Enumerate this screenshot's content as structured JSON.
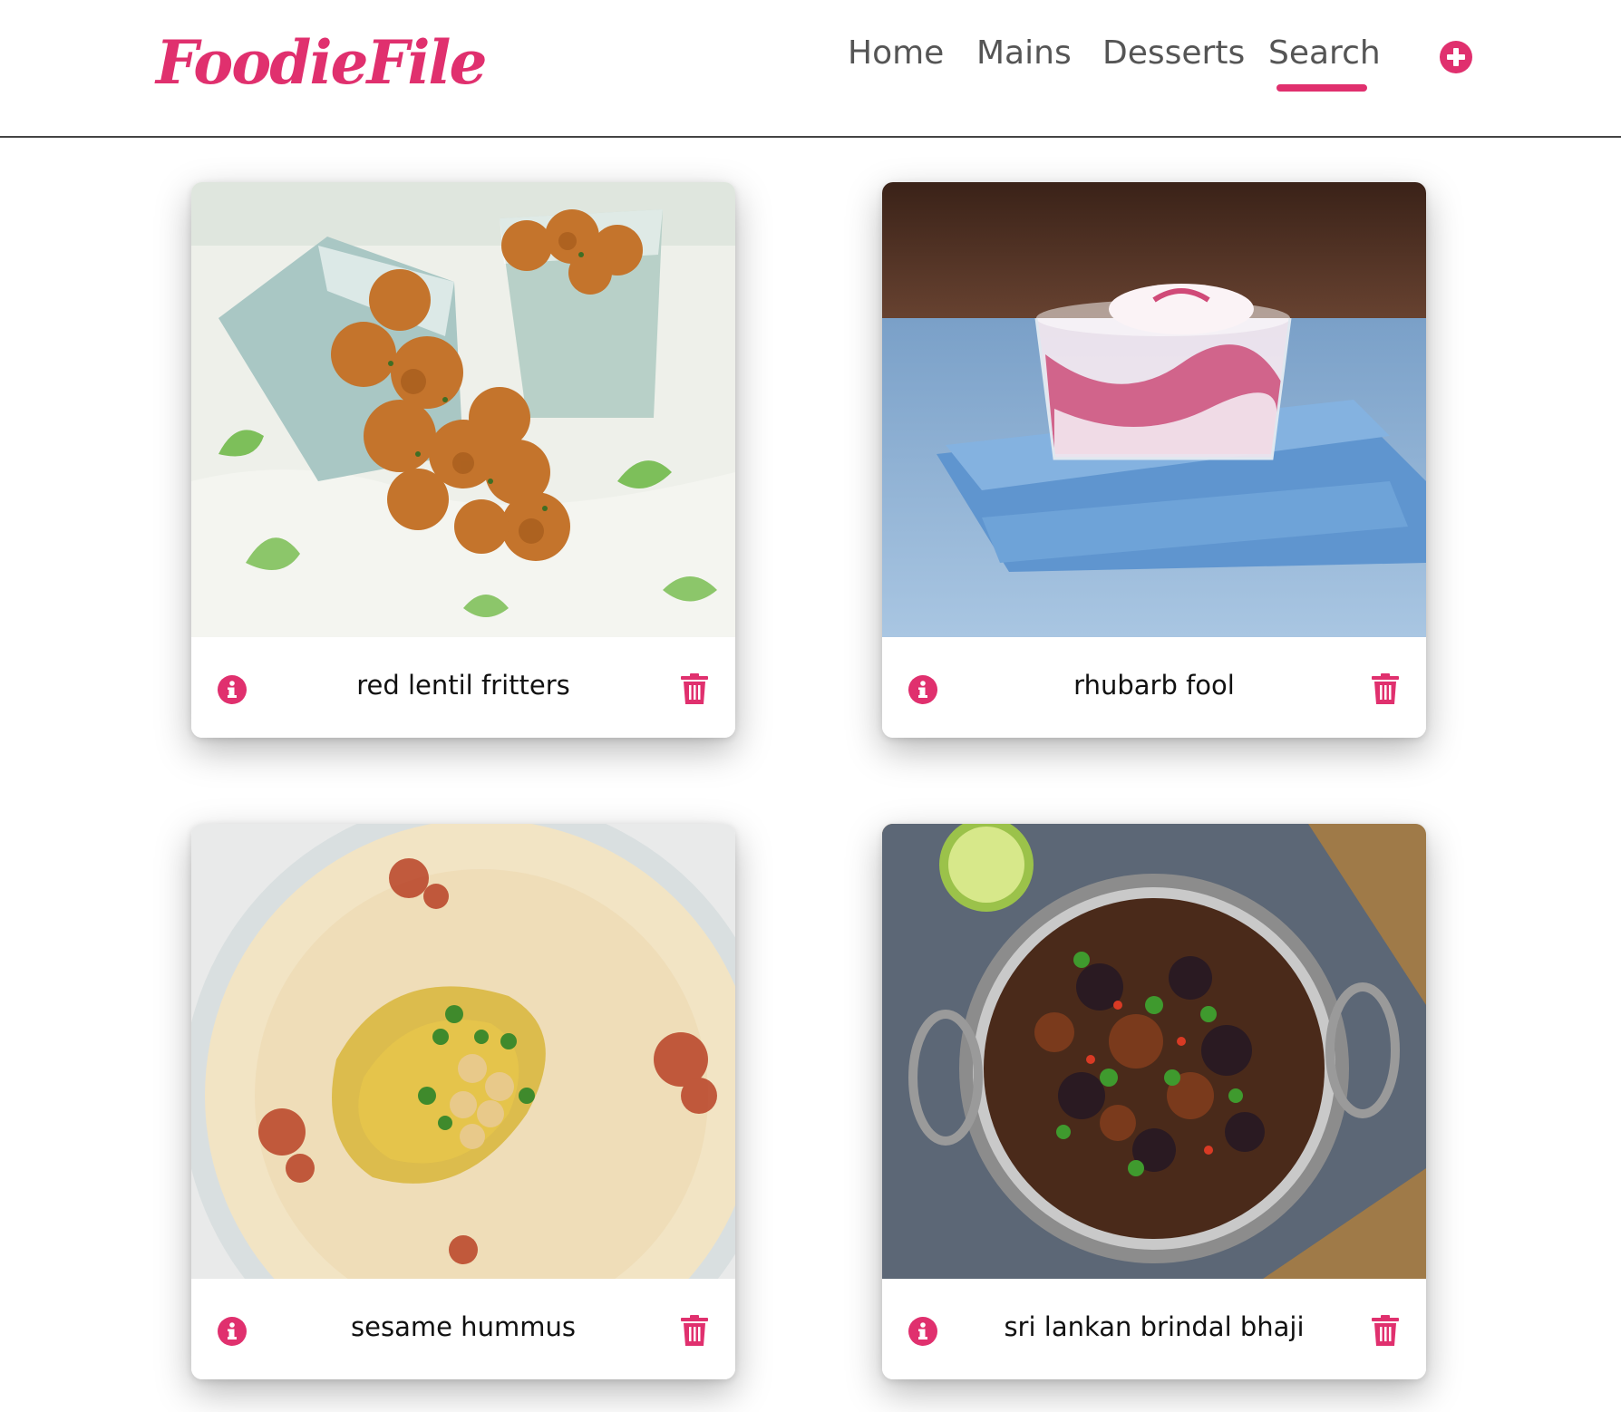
{
  "header": {
    "logo": "FoodieFile",
    "nav": [
      {
        "label": "Home",
        "active": false
      },
      {
        "label": "Mains",
        "active": false
      },
      {
        "label": "Desserts",
        "active": false
      },
      {
        "label": "Search",
        "active": true
      }
    ],
    "add_icon": "plus-circle-icon"
  },
  "colors": {
    "accent": "#e0306e",
    "nav_text": "#555555",
    "card_title": "#111111"
  },
  "recipes": [
    {
      "title": "red lentil fritters",
      "image": "fritters-photo",
      "info_icon": "info-icon",
      "delete_icon": "trash-icon"
    },
    {
      "title": "rhubarb fool",
      "image": "rhubarb-fool-photo",
      "info_icon": "info-icon",
      "delete_icon": "trash-icon"
    },
    {
      "title": "sesame hummus",
      "image": "hummus-photo",
      "info_icon": "info-icon",
      "delete_icon": "trash-icon"
    },
    {
      "title": "sri lankan brindal bhaji",
      "image": "bhaji-photo",
      "info_icon": "info-icon",
      "delete_icon": "trash-icon"
    }
  ]
}
